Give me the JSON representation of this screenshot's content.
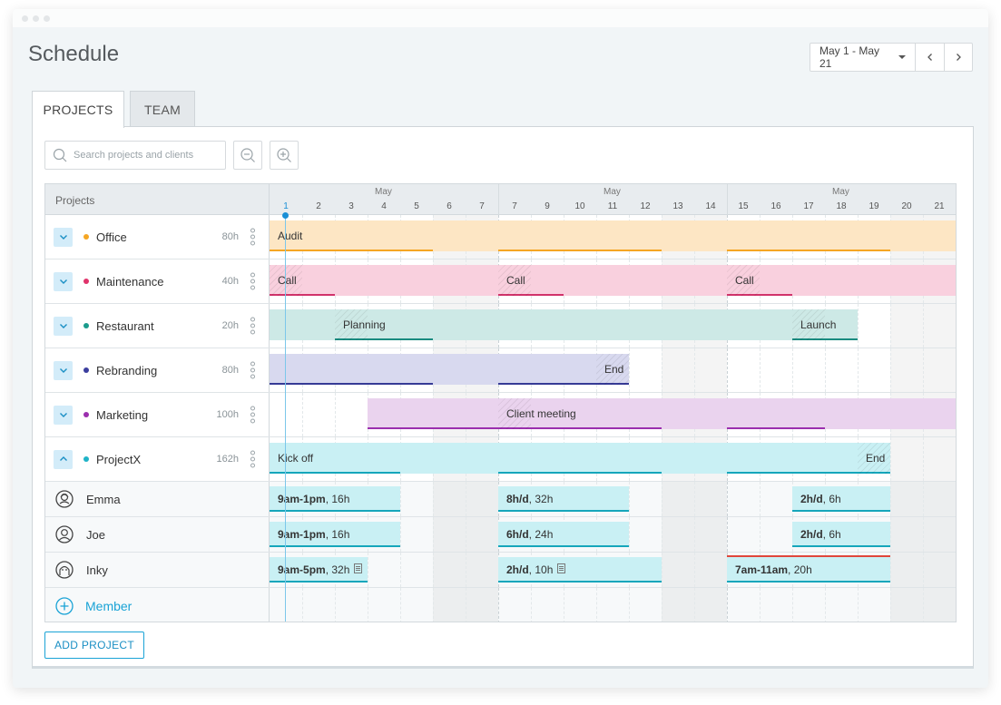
{
  "page": {
    "title": "Schedule"
  },
  "date_control": {
    "range": "May 1 - May 21"
  },
  "tabs": [
    {
      "label": "PROJECTS",
      "active": true
    },
    {
      "label": "TEAM",
      "active": false
    }
  ],
  "search": {
    "placeholder": "Search projects and clients"
  },
  "timeline": {
    "header_label": "Projects",
    "month_label": "May",
    "days": [
      "1",
      "2",
      "3",
      "4",
      "5",
      "6",
      "7",
      "7",
      "9",
      "10",
      "11",
      "12",
      "13",
      "14",
      "15",
      "16",
      "17",
      "18",
      "19",
      "20",
      "21"
    ],
    "today_index": 0
  },
  "projects": [
    {
      "name": "Office",
      "hours": "80h",
      "color": "#f5a623",
      "bar_color": "#fde6c4",
      "line_color": "#f5a623",
      "bars": [
        {
          "start": 0,
          "end": 5,
          "label": "Audit"
        },
        {
          "start": 7,
          "end": 12,
          "label": ""
        },
        {
          "start": 14,
          "end": 19,
          "label": ""
        }
      ],
      "fill": [
        0,
        21
      ]
    },
    {
      "name": "Maintenance",
      "hours": "40h",
      "color": "#e0336b",
      "bar_color": "#f9d0de",
      "line_color": "#d1336b",
      "bars": [
        {
          "start": 0,
          "end": 2,
          "label": "Call",
          "hatch": true
        },
        {
          "start": 7,
          "end": 9,
          "label": "Call",
          "hatch": true
        },
        {
          "start": 14,
          "end": 16,
          "label": "Call",
          "hatch": true
        }
      ],
      "fill": [
        0,
        21
      ]
    },
    {
      "name": "Restaurant",
      "hours": "20h",
      "color": "#1a9b8c",
      "bar_color": "#cde9e6",
      "line_color": "#1a8b80",
      "bars": [
        {
          "start": 2,
          "end": 5,
          "label": "Planning",
          "hatch": true
        },
        {
          "start": 16,
          "end": 18,
          "label": "Launch",
          "hatch": true
        }
      ],
      "fill": [
        0,
        18
      ]
    },
    {
      "name": "Rebranding",
      "hours": "80h",
      "color": "#3b3e9e",
      "bar_color": "#d8d9ef",
      "line_color": "#363a96",
      "bars": [
        {
          "start": 0,
          "end": 5,
          "label": ""
        },
        {
          "start": 7,
          "end": 11,
          "label": "End",
          "hatch_end": true
        }
      ],
      "fill": [
        0,
        11
      ]
    },
    {
      "name": "Marketing",
      "hours": "100h",
      "color": "#9b2fae",
      "bar_color": "#ead3ee",
      "line_color": "#9b2fae",
      "bars": [
        {
          "start": 3,
          "end": 12,
          "label": "Client meeting",
          "hatch": true,
          "label_at": 7
        },
        {
          "start": 14,
          "end": 17,
          "label": ""
        }
      ],
      "fill": [
        3,
        21
      ]
    },
    {
      "name": "ProjectX",
      "hours": "162h",
      "color": "#1fb3c7",
      "bar_color": "#c9f0f4",
      "line_color": "#15a6bb",
      "expanded": true,
      "bars": [
        {
          "start": 0,
          "end": 4,
          "label": "Kick off"
        },
        {
          "start": 7,
          "end": 12,
          "label": ""
        },
        {
          "start": 14,
          "end": 19,
          "label": "End",
          "hatch_end": true
        }
      ],
      "fill": [
        0,
        19
      ]
    }
  ],
  "members": [
    {
      "name": "Emma",
      "avatar": "emma-avatar-icon",
      "bars": [
        {
          "start": 0,
          "end": 4,
          "strong": "9am-1pm",
          "rest": ", 16h"
        },
        {
          "start": 7,
          "end": 11,
          "strong": "8h/d",
          "rest": ", 32h"
        },
        {
          "start": 16,
          "end": 19,
          "strong": "2h/d",
          "rest": ", 6h"
        }
      ]
    },
    {
      "name": "Joe",
      "avatar": "joe-avatar-icon",
      "bars": [
        {
          "start": 0,
          "end": 4,
          "strong": "9am-1pm",
          "rest": ", 16h"
        },
        {
          "start": 7,
          "end": 11,
          "strong": "6h/d",
          "rest": ", 24h"
        },
        {
          "start": 16,
          "end": 19,
          "strong": "2h/d",
          "rest": ", 6h"
        }
      ]
    },
    {
      "name": "Inky",
      "avatar": "inky-avatar-icon",
      "bars": [
        {
          "start": 0,
          "end": 3,
          "strong": "9am-5pm",
          "rest": ", 32h",
          "note": true
        },
        {
          "start": 7,
          "end": 12,
          "strong": "2h/d",
          "rest": ", 10h",
          "note": true
        },
        {
          "start": 14,
          "end": 19,
          "strong": "7am-11am",
          "rest": ", 20h",
          "overbooked": true
        }
      ]
    }
  ],
  "add_member": {
    "label": "Member"
  },
  "add_project": {
    "label": "ADD PROJECT"
  },
  "colors": {
    "accent": "#1aa3d6",
    "today": "#1a8fd6",
    "overbooked": "#e0463b",
    "member_bar": "#c9f0f4",
    "member_line": "#15a6bb"
  }
}
